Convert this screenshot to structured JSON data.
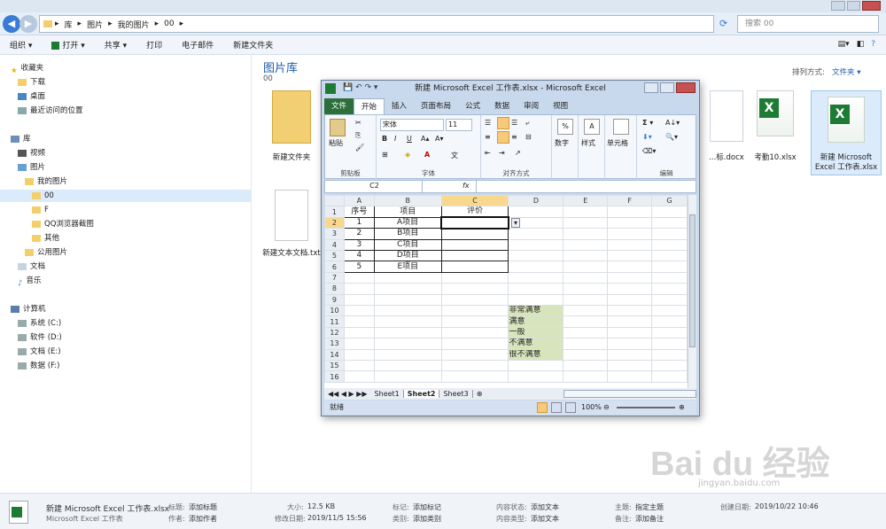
{
  "explorer": {
    "address_segments": [
      "库",
      "图片",
      "我的图片",
      "00"
    ],
    "search_placeholder": "搜索 00",
    "toolbar": [
      "组织 ▾",
      "打开 ▾",
      "共享 ▾",
      "打印",
      "电子邮件",
      "新建文件夹"
    ],
    "sort_label": "排列方式:",
    "sort_value": "文件夹 ▾",
    "library_title": "图片库",
    "library_sub": "00",
    "nav": {
      "favorites": "收藏夹",
      "downloads": "下载",
      "desktop": "桌面",
      "recent": "最近访问的位置",
      "libraries": "库",
      "videos": "视频",
      "pictures": "图片",
      "my_pictures": "我的图片",
      "f00": "00",
      "fF": "F",
      "fqq": "QQ浏览器截图",
      "fother": "其他",
      "public_pictures": "公用图片",
      "documents": "文档",
      "music": "音乐",
      "computer": "计算机",
      "drive_c": "系统 (C:)",
      "drive_d": "软件 (D:)",
      "drive_e": "文档 (E:)",
      "drive_f": "数据 (F:)"
    },
    "files": {
      "folder": "新建文件夹",
      "txt": "新建文本文档.txt",
      "docx": "...标.docx",
      "kaoqin": "考勤10.xlsx",
      "xlsx": "新建 Microsoft Excel 工作表.xlsx"
    },
    "details": {
      "name": "新建 Microsoft Excel 工作表.xlsx",
      "type": "Microsoft Excel 工作表",
      "title_k": "标题:",
      "title_v": "添加标题",
      "author_k": "作者:",
      "author_v": "添加作者",
      "size_k": "大小:",
      "size_v": "12.5 KB",
      "modified_k": "修改日期:",
      "modified_v": "2019/11/5 15:56",
      "tags_k": "标记:",
      "tags_v": "添加标记",
      "category_k": "类别:",
      "category_v": "添加类别",
      "status_k": "内容状态:",
      "status_v": "添加文本",
      "ctype_k": "内容类型:",
      "ctype_v": "添加文本",
      "subject_k": "主题:",
      "subject_v": "指定主题",
      "comments_k": "备注:",
      "comments_v": "添加备注",
      "created_k": "创建日期:",
      "created_v": "2019/10/22 10:46"
    }
  },
  "excel": {
    "title": "新建 Microsoft Excel 工作表.xlsx - Microsoft Excel",
    "tabs": [
      "文件",
      "开始",
      "插入",
      "页面布局",
      "公式",
      "数据",
      "审阅",
      "视图"
    ],
    "font_name": "宋体",
    "font_size": "11",
    "groups": [
      "剪贴板",
      "字体",
      "对齐方式",
      "数字",
      "样式",
      "单元格",
      "编辑"
    ],
    "paste": "粘贴",
    "number": "数字",
    "style": "样式",
    "cells": "单元格",
    "namebox": "C2",
    "fx": "fx",
    "columns": [
      "A",
      "B",
      "C",
      "D",
      "E",
      "F",
      "G"
    ],
    "rows": [
      [
        "序号",
        "项目",
        "评价",
        "",
        "",
        "",
        ""
      ],
      [
        "1",
        "A项目",
        "",
        "",
        "",
        "",
        ""
      ],
      [
        "2",
        "B项目",
        "",
        "",
        "",
        "",
        ""
      ],
      [
        "3",
        "C项目",
        "",
        "",
        "",
        "",
        ""
      ],
      [
        "4",
        "D项目",
        "",
        "",
        "",
        "",
        ""
      ],
      [
        "5",
        "E项目",
        "",
        "",
        "",
        "",
        ""
      ],
      [
        "",
        "",
        "",
        "",
        "",
        "",
        ""
      ],
      [
        "",
        "",
        "",
        "",
        "",
        "",
        ""
      ],
      [
        "",
        "",
        "",
        "",
        "",
        "",
        ""
      ],
      [
        "",
        "",
        "",
        "非常满意",
        "",
        "",
        ""
      ],
      [
        "",
        "",
        "",
        "满意",
        "",
        "",
        ""
      ],
      [
        "",
        "",
        "",
        "一般",
        "",
        "",
        ""
      ],
      [
        "",
        "",
        "",
        "不满意",
        "",
        "",
        ""
      ],
      [
        "",
        "",
        "",
        "很不满意",
        "",
        "",
        ""
      ],
      [
        "",
        "",
        "",
        "",
        "",
        "",
        ""
      ],
      [
        "",
        "",
        "",
        "",
        "",
        "",
        ""
      ]
    ],
    "sheets": [
      "Sheet1",
      "Sheet2",
      "Sheet3"
    ],
    "status": "就绪",
    "zoom": "100%"
  },
  "watermark": {
    "text": "Bai du 经验",
    "sub": "jingyan.baidu.com"
  }
}
